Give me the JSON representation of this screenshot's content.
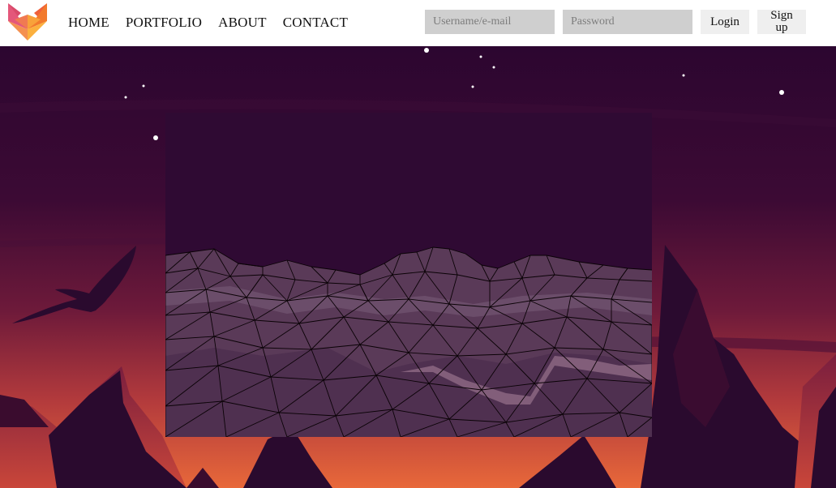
{
  "brand": {
    "logo_icon": "fox-logo-icon"
  },
  "nav": {
    "items": [
      {
        "label": "HOME"
      },
      {
        "label": "PORTFOLIO"
      },
      {
        "label": "ABOUT"
      },
      {
        "label": "CONTACT"
      }
    ]
  },
  "auth": {
    "username_placeholder": "Username/e-mail",
    "username_value": "",
    "password_placeholder": "Password",
    "password_value": "",
    "login_label": "Login",
    "signup_label": "Sign up"
  },
  "colors": {
    "sky_top": "#2c0630",
    "sky_mid": "#5a1236",
    "horizon": "#c0483a",
    "glow": "#e86a3c",
    "silhouette": "#2a0a2e",
    "terrain_fill": "#5a3a58",
    "terrain_lines": "#0a0206",
    "viewport_bg": "#2f0a33",
    "input_bg": "#cfcfcf",
    "button_bg": "#efefef"
  }
}
